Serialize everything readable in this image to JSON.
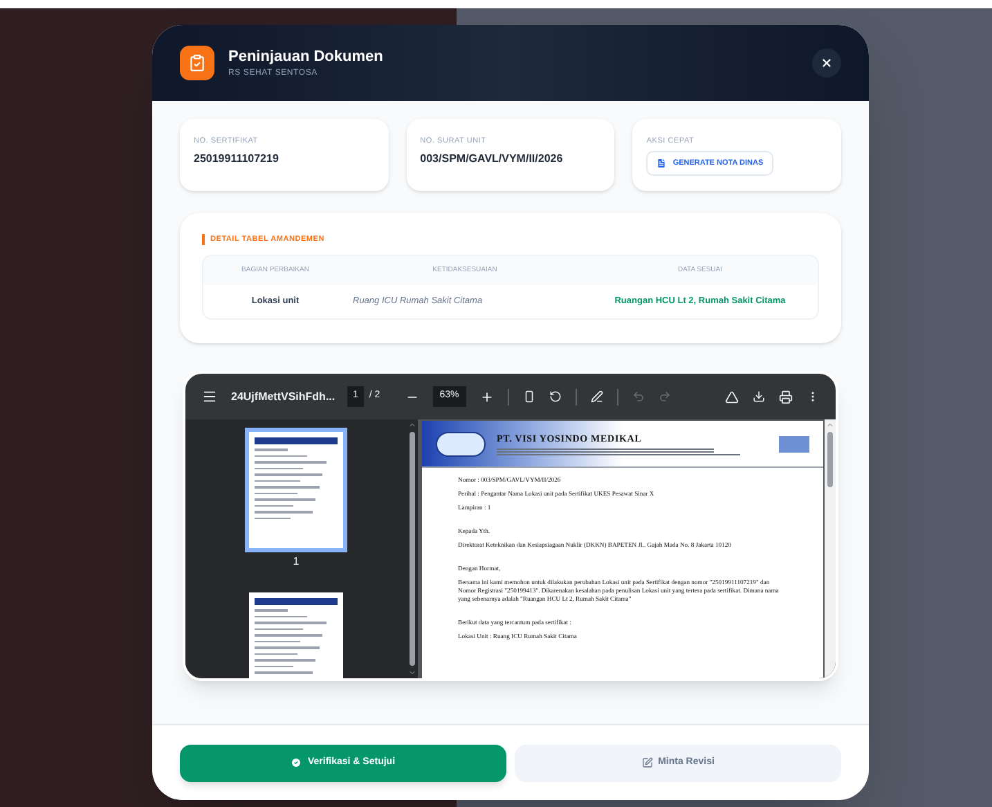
{
  "modal": {
    "title": "Peninjauan Dokumen",
    "subtitle": "RS SEHAT SENTOSA"
  },
  "info_cards": [
    {
      "kind": "value",
      "label": "NO. SERTIFIKAT",
      "value": "25019911107219"
    },
    {
      "kind": "value",
      "label": "NO. SURAT UNIT",
      "value": "003/SPM/GAVL/VYM/II/2026"
    },
    {
      "kind": "action",
      "label": "AKSI CEPAT",
      "button": "GENERATE NOTA DINAS"
    }
  ],
  "amendment_table": {
    "title": "DETAIL TABEL AMANDEMEN",
    "columns": [
      "BAGIAN PERBAIKAN",
      "KETIDAKSESUAIAN",
      "DATA SESUAI"
    ],
    "rows": [
      {
        "cells": [
          "Lokasi unit",
          "Ruang ICU Rumah Sakit Citama",
          "Ruangan HCU Lt 2, Rumah Sakit Citama"
        ]
      }
    ]
  },
  "pdf_viewer": {
    "filename": "24UjfMettVSihFdh...",
    "page": "1",
    "page_count": "/ 2",
    "zoom": "63%",
    "tools": [
      {
        "kind": "fit",
        "disabled": false
      },
      {
        "kind": "rotate",
        "disabled": false
      },
      {
        "kind": "annotate",
        "disabled": false
      },
      {
        "kind": "undo",
        "disabled": true
      },
      {
        "kind": "redo",
        "disabled": true
      }
    ],
    "thumbnails": [
      {
        "label": "1",
        "selected": true
      },
      {
        "selected": false
      }
    ],
    "document": {
      "company": "PT. VISI YOSINDO MEDIKAL",
      "paragraphs": [
        {
          "kind": "line",
          "text": "Nomor : 003/SPM/GAVL/VYM/II/2026"
        },
        {
          "kind": "line",
          "text": "Perihal : Pengantar Nama Lokasi unit pada Sertifikat UKES Pesawat Sinar X"
        },
        {
          "kind": "line",
          "text": "Lampiran : 1"
        },
        {
          "kind": "gap",
          "text": "Kepada Yth."
        },
        {
          "kind": "line",
          "text": "Direktorat Keteknikan dan Kesiapsiagaan Nuklir (DKKN) BAPETEN Jl.. Gajah Mada No. 8 Jakarta 10120"
        },
        {
          "kind": "gap",
          "text": "Dengan Hormat,"
        },
        {
          "kind": "line",
          "text": "Bersama ini kami memohon untuk dilakukan perubahan Lokasi unit pada Sertifikat dengan nomor \"25019911107219\" dan Nomor Registrasi \"250199413\". Dikarenakan kesalahan pada penulisan Lokasi unit yang tertera pada sertifikat. Dimana nama yang sebenarnya adalah \"Ruangan HCU Lt 2, Rumah Sakit Citama\""
        },
        {
          "kind": "gap",
          "text": "Berikut data yang tercantum pada sertifikat :"
        },
        {
          "kind": "line",
          "text": "Lokasi Unit : Ruang ICU Rumah Sakit Citama"
        }
      ]
    }
  },
  "actions": [
    {
      "kind": "primary",
      "label": "Verifikasi & Setujui"
    },
    {
      "kind": "secondary",
      "label": "Minta Revisi"
    }
  ]
}
